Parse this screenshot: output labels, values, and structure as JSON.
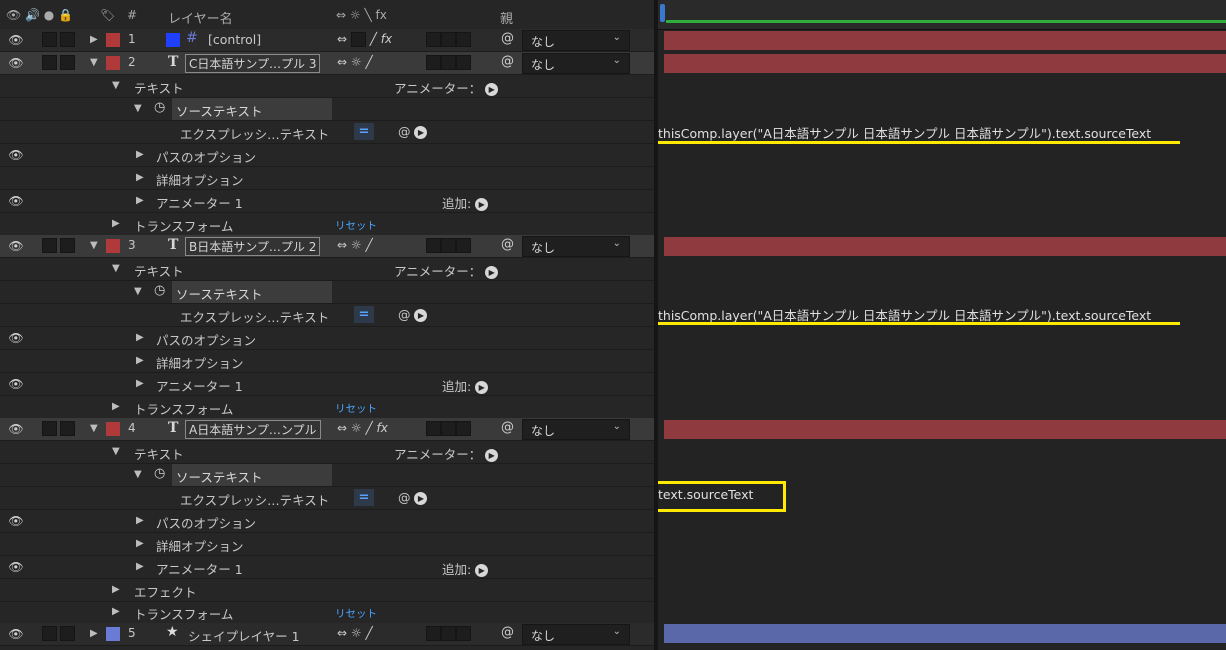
{
  "header": {
    "layer_name_col": "レイヤー名",
    "num_col": "#",
    "parent_col": "親",
    "switch_icons": "⇔ ☼ ╲ fx"
  },
  "layers": [
    {
      "num": "1",
      "name": "[control]",
      "parent": "なし"
    },
    {
      "num": "2",
      "name": "C日本語サンプ…プル 3",
      "parent": "なし"
    },
    {
      "num": "3",
      "name": "B日本語サンプ…プル 2",
      "parent": "なし"
    },
    {
      "num": "4",
      "name": "A日本語サンプ…ンプル",
      "parent": "なし"
    },
    {
      "num": "5",
      "name": "シェイプレイヤー 1",
      "parent": "なし"
    }
  ],
  "props": {
    "text": "テキスト",
    "animator_label": "アニメーター：",
    "source_text": "ソーステキスト",
    "expression": "エクスプレッシ…テキスト",
    "path_options": "パスのオプション",
    "more_options": "詳細オプション",
    "animator1": "アニメーター 1",
    "add": "追加:",
    "transform": "トランスフォーム",
    "reset": "リセット",
    "effect": "エフェクト"
  },
  "expressions": {
    "layer2": "thisComp.layer(\"A日本語サンプル 日本語サンプル 日本語サンプル\").text.sourceText",
    "layer3": "thisComp.layer(\"A日本語サンプル 日本語サンプル 日本語サンプル\").text.sourceText",
    "layer4": "text.sourceText"
  },
  "colors": {
    "red_label": "#b03a3a",
    "blue_label": "#6a7bd6",
    "layer_bar_red": "#8f3a3f",
    "layer_bar_blue": "#5a67a8",
    "highlight": "#ffea00",
    "control_swatch": "#2040ff"
  },
  "icons": {
    "eye": "eye-icon",
    "lock": "lock-icon",
    "label": "tag-icon",
    "stopwatch": "stopwatch-icon",
    "spiral": "pickwhip-icon",
    "text_layer": "text-layer-icon",
    "shape_layer": "star-icon",
    "null_layer": "hash-icon"
  }
}
